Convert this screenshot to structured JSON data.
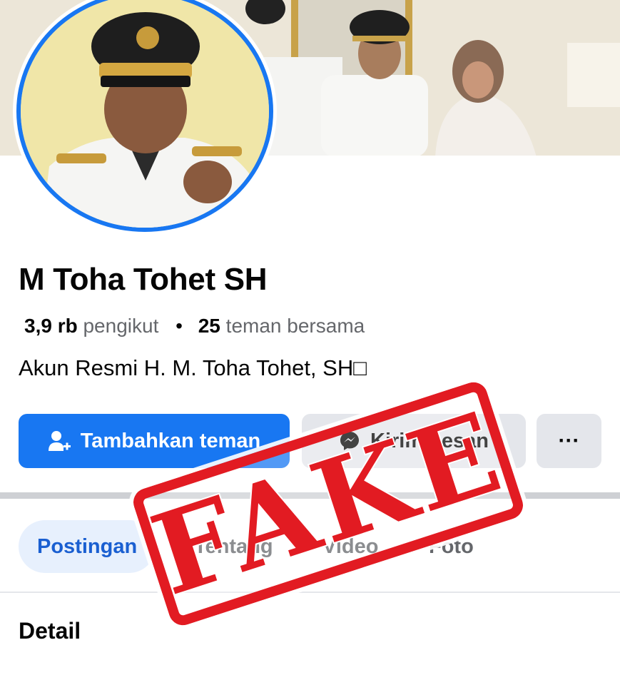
{
  "profile": {
    "name": "M Toha Tohet SH",
    "followers_count": "3,9 rb",
    "followers_label": "pengikut",
    "separator": "•",
    "mutual_count": "25",
    "mutual_label": "teman bersama",
    "bio": "Akun Resmi H. M. Toha Tohet, SH□"
  },
  "actions": {
    "add_friend": "Tambahkan teman",
    "message": "Kirim pesan",
    "more": "···"
  },
  "tabs": [
    {
      "label": "Postingan",
      "active": true
    },
    {
      "label": "Tentang",
      "active": false
    },
    {
      "label": "Video",
      "active": false
    },
    {
      "label": "Foto",
      "active": false
    }
  ],
  "section": {
    "title": "Detail"
  },
  "stamp": {
    "text": "FAKE",
    "color": "#e21b22"
  },
  "colors": {
    "accent": "#1877f2",
    "secondary_button": "#e4e6eb",
    "active_tab_bg": "#e7f0fd"
  },
  "icons": [
    "add-friend-icon",
    "messenger-icon",
    "more-icon"
  ]
}
